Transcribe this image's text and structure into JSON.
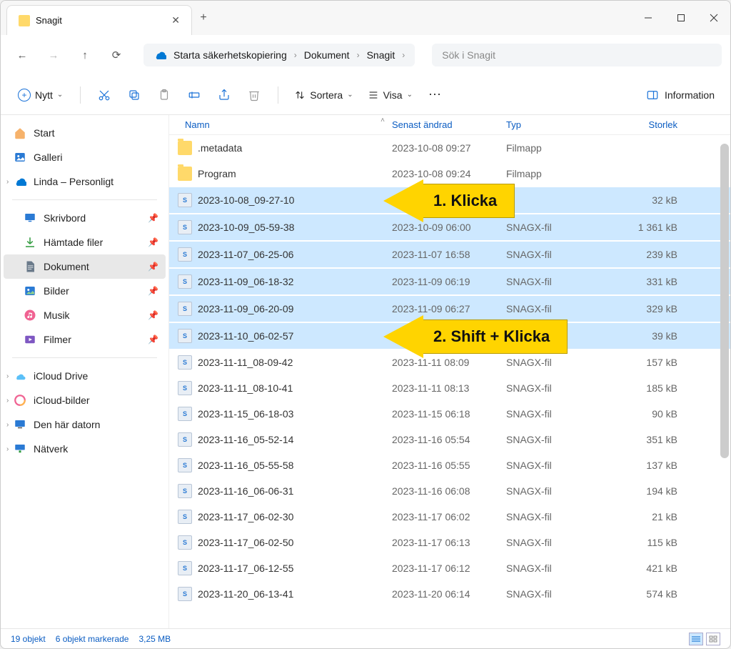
{
  "tab": {
    "title": "Snagit"
  },
  "breadcrumb": {
    "root": "Starta säkerhetskopiering",
    "items": [
      "Dokument",
      "Snagit"
    ]
  },
  "search": {
    "placeholder": "Sök i Snagit"
  },
  "toolbar": {
    "new": "Nytt",
    "sort": "Sortera",
    "view": "Visa",
    "info": "Information"
  },
  "sidebar": {
    "top": [
      {
        "label": "Start",
        "icon": "home"
      },
      {
        "label": "Galleri",
        "icon": "gallery"
      },
      {
        "label": "Linda – Personligt",
        "icon": "onedrive",
        "expandable": true
      }
    ],
    "quick": [
      {
        "label": "Skrivbord",
        "icon": "desktop"
      },
      {
        "label": "Hämtade filer",
        "icon": "downloads"
      },
      {
        "label": "Dokument",
        "icon": "document",
        "active": true
      },
      {
        "label": "Bilder",
        "icon": "pictures"
      },
      {
        "label": "Musik",
        "icon": "music"
      },
      {
        "label": "Filmer",
        "icon": "videos"
      }
    ],
    "bottom": [
      {
        "label": "iCloud Drive",
        "icon": "icloud",
        "expandable": true
      },
      {
        "label": "iCloud-bilder",
        "icon": "icloud-photos",
        "expandable": true
      },
      {
        "label": "Den här datorn",
        "icon": "pc",
        "expandable": true
      },
      {
        "label": "Nätverk",
        "icon": "network",
        "expandable": true
      }
    ]
  },
  "columns": {
    "name": "Namn",
    "date": "Senast ändrad",
    "type": "Typ",
    "size": "Storlek"
  },
  "rows": [
    {
      "name": ".metadata",
      "date": "2023-10-08 09:27",
      "type": "Filmapp",
      "size": "",
      "icon": "folder"
    },
    {
      "name": "Program",
      "date": "2023-10-08 09:24",
      "type": "Filmapp",
      "size": "",
      "icon": "folder"
    },
    {
      "name": "2023-10-08_09-27-10",
      "date": "",
      "type": "",
      "size": "32 kB",
      "icon": "snag",
      "selected": true
    },
    {
      "name": "2023-10-09_05-59-38",
      "date": "2023-10-09 06:00",
      "type": "SNAGX-fil",
      "size": "1 361 kB",
      "icon": "snag",
      "selected": true
    },
    {
      "name": "2023-11-07_06-25-06",
      "date": "2023-11-07 16:58",
      "type": "SNAGX-fil",
      "size": "239 kB",
      "icon": "snag",
      "selected": true
    },
    {
      "name": "2023-11-09_06-18-32",
      "date": "2023-11-09 06:19",
      "type": "SNAGX-fil",
      "size": "331 kB",
      "icon": "snag",
      "selected": true
    },
    {
      "name": "2023-11-09_06-20-09",
      "date": "2023-11-09 06:27",
      "type": "SNAGX-fil",
      "size": "329 kB",
      "icon": "snag",
      "selected": true
    },
    {
      "name": "2023-11-10_06-02-57",
      "date": "",
      "type": "",
      "size": "39 kB",
      "icon": "snag",
      "selected": true
    },
    {
      "name": "2023-11-11_08-09-42",
      "date": "2023-11-11 08:09",
      "type": "SNAGX-fil",
      "size": "157 kB",
      "icon": "snag"
    },
    {
      "name": "2023-11-11_08-10-41",
      "date": "2023-11-11 08:13",
      "type": "SNAGX-fil",
      "size": "185 kB",
      "icon": "snag"
    },
    {
      "name": "2023-11-15_06-18-03",
      "date": "2023-11-15 06:18",
      "type": "SNAGX-fil",
      "size": "90 kB",
      "icon": "snag"
    },
    {
      "name": "2023-11-16_05-52-14",
      "date": "2023-11-16 05:54",
      "type": "SNAGX-fil",
      "size": "351 kB",
      "icon": "snag"
    },
    {
      "name": "2023-11-16_05-55-58",
      "date": "2023-11-16 05:55",
      "type": "SNAGX-fil",
      "size": "137 kB",
      "icon": "snag"
    },
    {
      "name": "2023-11-16_06-06-31",
      "date": "2023-11-16 06:08",
      "type": "SNAGX-fil",
      "size": "194 kB",
      "icon": "snag"
    },
    {
      "name": "2023-11-17_06-02-30",
      "date": "2023-11-17 06:02",
      "type": "SNAGX-fil",
      "size": "21 kB",
      "icon": "snag"
    },
    {
      "name": "2023-11-17_06-02-50",
      "date": "2023-11-17 06:13",
      "type": "SNAGX-fil",
      "size": "115 kB",
      "icon": "snag"
    },
    {
      "name": "2023-11-17_06-12-55",
      "date": "2023-11-17 06:12",
      "type": "SNAGX-fil",
      "size": "421 kB",
      "icon": "snag"
    },
    {
      "name": "2023-11-20_06-13-41",
      "date": "2023-11-20 06:14",
      "type": "SNAGX-fil",
      "size": "574 kB",
      "icon": "snag"
    }
  ],
  "annotations": {
    "arrow1": "1. Klicka",
    "arrow2": "2. Shift + Klicka"
  },
  "status": {
    "count": "19 objekt",
    "selected": "6 objekt markerade",
    "size": "3,25 MB"
  }
}
